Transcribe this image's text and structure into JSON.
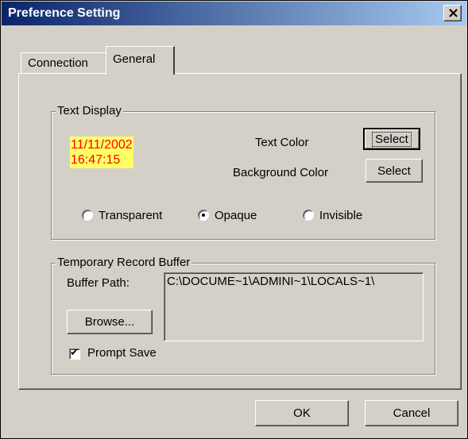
{
  "window": {
    "title": "Preference Setting",
    "close_label": "×"
  },
  "tabs": [
    {
      "label": "Connection",
      "active": false
    },
    {
      "label": "General",
      "active": true
    }
  ],
  "text_display": {
    "group_label": "Text Display",
    "sample_date": "11/11/2002",
    "sample_time": "16:47:15",
    "sample_colors": {
      "text": "#ff0000",
      "background": "#ffff66"
    },
    "text_color_label": "Text Color",
    "text_color_button": "Select",
    "bg_color_label": "Background Color",
    "bg_color_button": "Select",
    "modes": [
      {
        "label": "Transparent",
        "selected": false
      },
      {
        "label": "Opaque",
        "selected": true
      },
      {
        "label": "Invisible",
        "selected": false
      }
    ]
  },
  "buffer": {
    "group_label": "Temporary Record Buffer",
    "path_label": "Buffer Path:",
    "path_value": "C:\\DOCUME~1\\ADMINI~1\\LOCALS~1\\",
    "browse_label": "Browse...",
    "prompt_save_label": "Prompt Save",
    "prompt_save_checked": true
  },
  "footer": {
    "ok_label": "OK",
    "cancel_label": "Cancel"
  }
}
